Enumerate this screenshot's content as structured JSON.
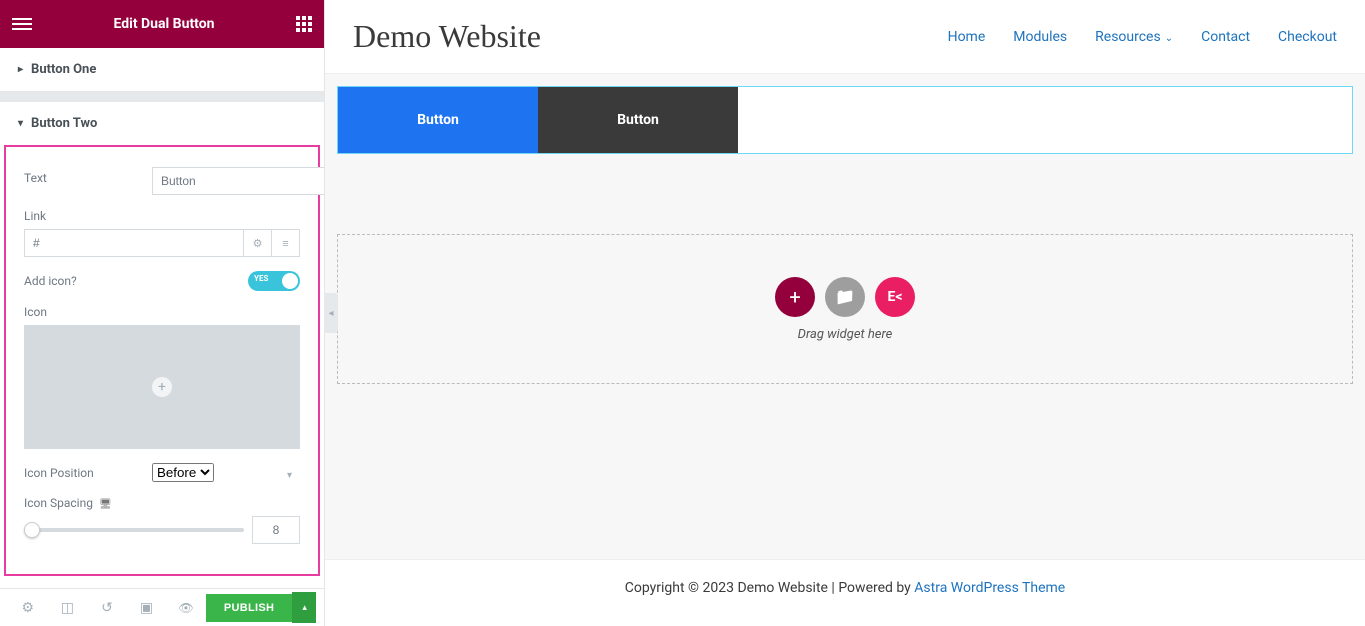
{
  "sidebar": {
    "title": "Edit Dual Button",
    "accordion1_label": "Button One",
    "accordion2_label": "Button Two",
    "controls": {
      "text_label": "Text",
      "text_value": "Button",
      "link_label": "Link",
      "link_value": "#",
      "add_icon_label": "Add icon?",
      "add_icon_toggle_text": "YES",
      "icon_label": "Icon",
      "icon_position_label": "Icon Position",
      "icon_position_value": "Before",
      "icon_spacing_label": "Icon Spacing",
      "icon_spacing_value": "8"
    },
    "footer": {
      "publish_label": "PUBLISH"
    }
  },
  "preview": {
    "site_title": "Demo Website",
    "nav": {
      "home": "Home",
      "modules": "Modules",
      "resources": "Resources",
      "contact": "Contact",
      "checkout": "Checkout"
    },
    "button1_label": "Button",
    "button2_label": "Button",
    "drop_text": "Drag widget here",
    "footer_text_prefix": "Copyright © 2023 Demo Website | Powered by ",
    "footer_link_text": "Astra WordPress Theme"
  }
}
